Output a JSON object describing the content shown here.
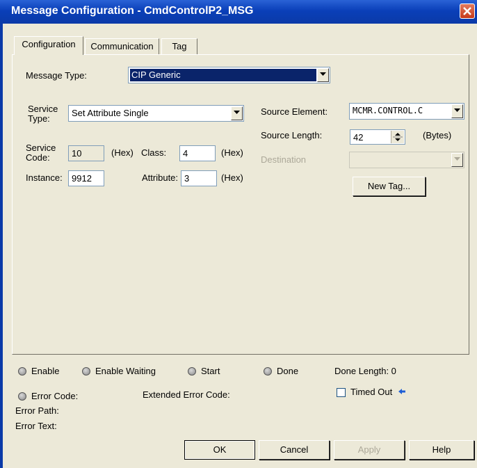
{
  "window": {
    "title": "Message Configuration - CmdControlP2_MSG"
  },
  "tabs": [
    "Configuration",
    "Communication",
    "Tag"
  ],
  "config": {
    "message_type_label": "Message Type:",
    "message_type_value": "CIP Generic",
    "service_type_label_1": "Service",
    "service_type_label_2": "Type:",
    "service_type_value": "Set Attribute Single",
    "service_code_label_1": "Service",
    "service_code_label_2": "Code:",
    "service_code_value": "10",
    "hex_label": "(Hex)",
    "class_label": "Class:",
    "class_value": "4",
    "instance_label": "Instance:",
    "instance_value": "9912",
    "attribute_label": "Attribute:",
    "attribute_value": "3",
    "source_element_label": "Source Element:",
    "source_element_value": "MCMR.CONTROL.C",
    "source_length_label": "Source Length:",
    "source_length_value": "42",
    "bytes_label": "(Bytes)",
    "destination_label": "Destination",
    "destination_value": "",
    "new_tag_button": "New Tag..."
  },
  "status": {
    "enable": "Enable",
    "enable_waiting": "Enable Waiting",
    "start": "Start",
    "done": "Done",
    "done_length": "Done Length: 0",
    "error_code": "Error Code:",
    "extended_error_code": "Extended Error Code:",
    "timed_out": "Timed Out",
    "error_path": "Error Path:",
    "error_text": "Error Text:"
  },
  "buttons": {
    "ok": "OK",
    "cancel": "Cancel",
    "apply": "Apply",
    "help": "Help"
  },
  "colors": {
    "title_bar": "#0a3fb8",
    "selection": "#0a246a",
    "dialog_bg": "#ece9d8",
    "close_button": "#c73a1a"
  },
  "icons": {
    "close": "close-icon",
    "dropdown": "chevron-down-icon",
    "spinner": "spinner-arrows-icon",
    "timed_out_pointer": "arrow-left-icon"
  }
}
